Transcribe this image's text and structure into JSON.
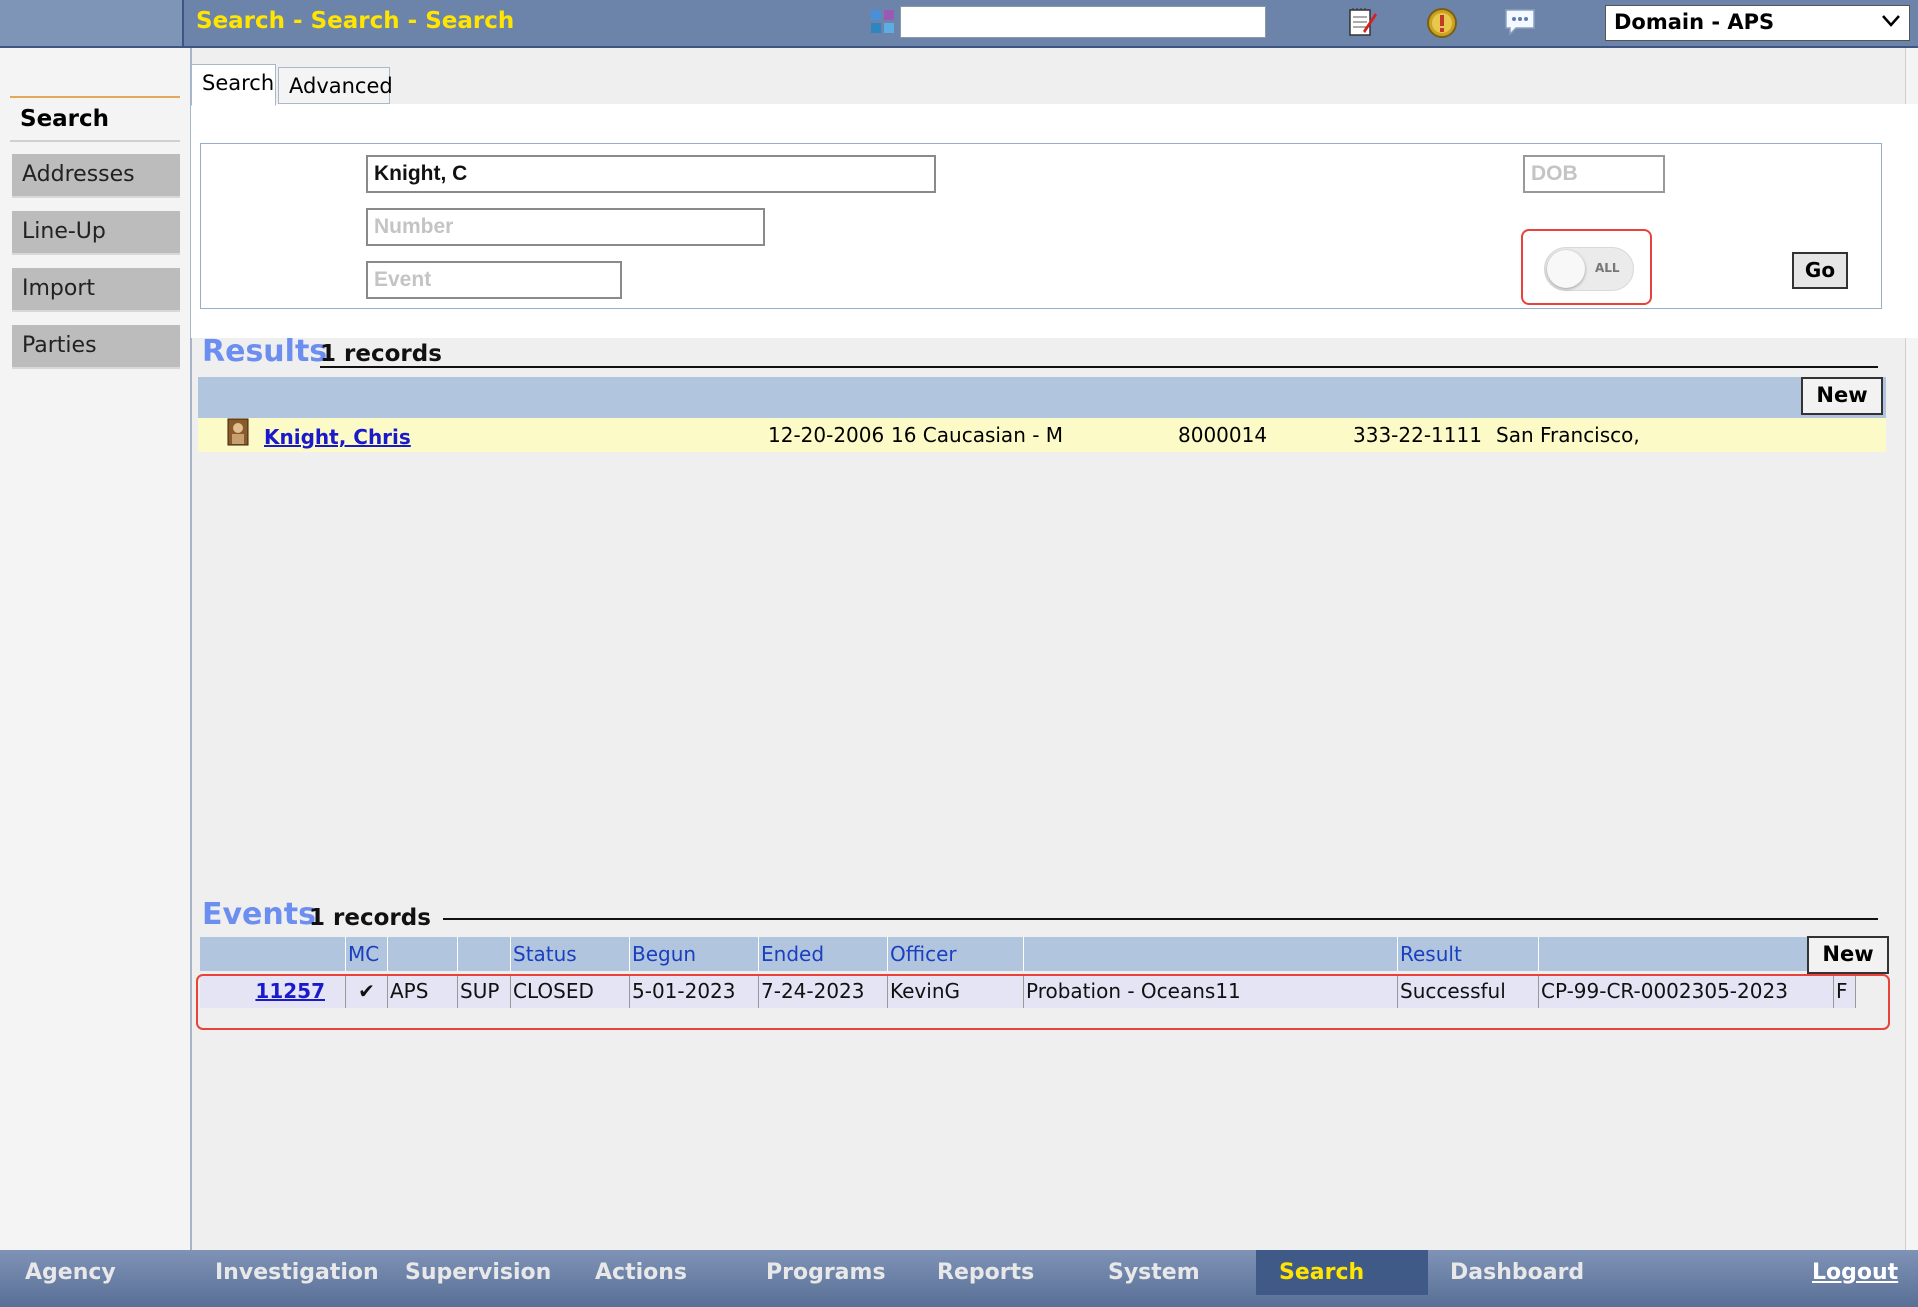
{
  "header": {
    "title": "Search - Search - Search",
    "quick_search_value": "",
    "domain": "Domain - APS"
  },
  "sidebar": {
    "items": [
      {
        "label": "Search",
        "selected": true
      },
      {
        "label": "Addresses"
      },
      {
        "label": "Line-Up"
      },
      {
        "label": "Import"
      },
      {
        "label": "Parties"
      }
    ]
  },
  "tabs": [
    {
      "label": "Search",
      "active": true
    },
    {
      "label": "Advanced"
    }
  ],
  "form": {
    "name_value": "Knight, C",
    "number_placeholder": "Number",
    "event_placeholder": "Event",
    "dob_placeholder": "DOB",
    "toggle_label": "ALL",
    "go_label": "Go"
  },
  "results": {
    "title": "Results",
    "count": "1 records",
    "new_label": "New",
    "rows": [
      {
        "name": "Knight, Chris",
        "dob": "12-20-2006",
        "desc": "16 Caucasian - M",
        "number": "8000014",
        "ssn": "333-22-1111",
        "city": "San Francisco,"
      }
    ]
  },
  "events": {
    "title": "Events",
    "count": "1 records",
    "new_label": "New",
    "headers": [
      "",
      "MC",
      "",
      "",
      "Status",
      "Begun",
      "Ended",
      "Officer",
      "",
      "Result",
      ""
    ],
    "rows": [
      {
        "id": "11257",
        "mc": "✔",
        "agency": "APS",
        "type": "SUP",
        "status": "CLOSED",
        "begun": "5-01-2023",
        "ended": "7-24-2023",
        "officer": "KevinG",
        "program": "Probation - Oceans11",
        "result": "Successful",
        "case": "CP-99-CR-0002305-2023",
        "flag": "F"
      }
    ]
  },
  "bottom_nav": {
    "items": [
      "Agency",
      "Investigation",
      "Supervision",
      "Actions",
      "Programs",
      "Reports",
      "System",
      "Search",
      "Dashboard"
    ],
    "active": "Search",
    "logout": "Logout"
  },
  "colors": {
    "title_yellow": "#ffe500",
    "header_blue": "#6d84aa",
    "section_blue": "#6b8ef0",
    "highlight_red": "#e8423a",
    "result_row": "#fcfac6"
  }
}
